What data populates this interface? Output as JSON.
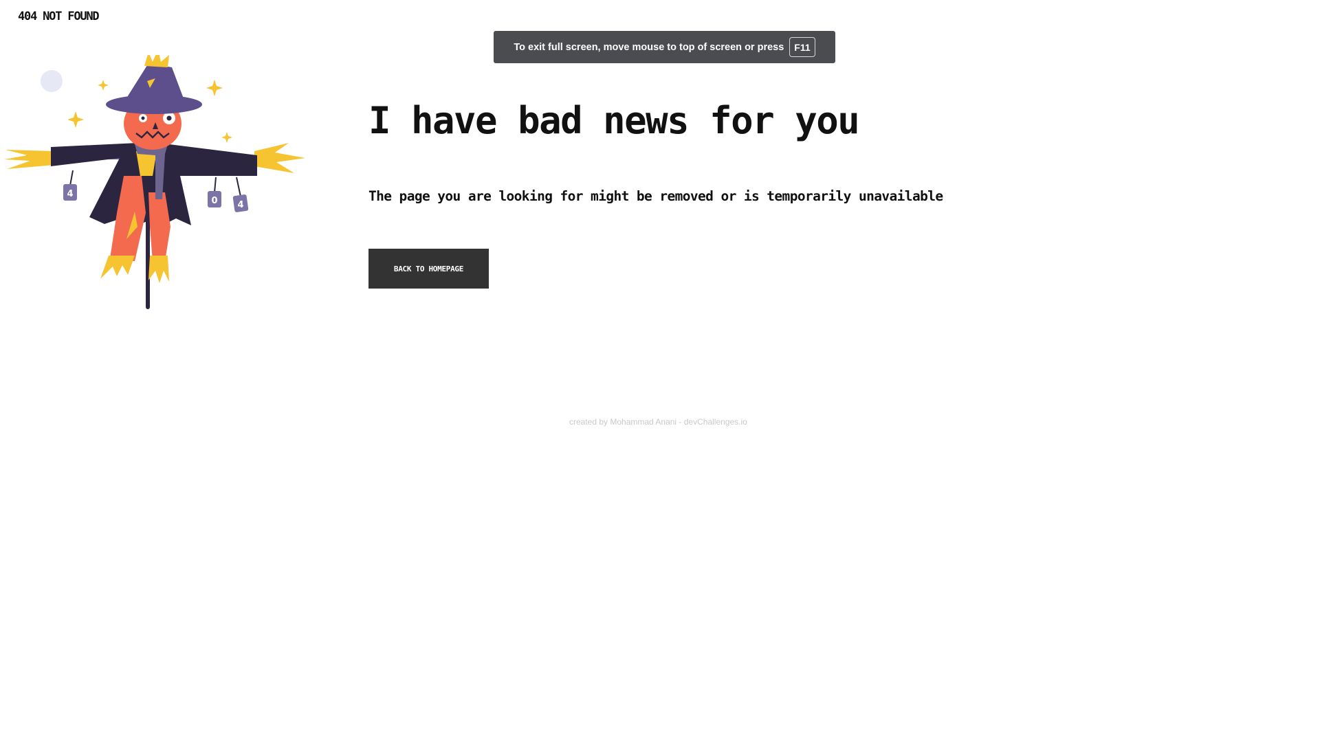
{
  "brand": {
    "label": "404 NOT FOUND"
  },
  "fullscreen_notice": {
    "text": "To exit full screen, move mouse to top of screen or press",
    "key": "F11"
  },
  "illustration": {
    "icon": "scarecrow-illustration",
    "tag_labels": [
      "4",
      "0",
      "4"
    ],
    "colors": {
      "hat": "#5c4f8c",
      "face": "#f46a4e",
      "coat": "#2c2540",
      "scarf": "#6e6490",
      "straw": "#f5c430",
      "pants": "#f46a4e",
      "moon": "#e7e8f5"
    }
  },
  "main": {
    "headline": "I have bad news for you",
    "subtext": "The page you are looking for might be removed or is temporarily unavailable",
    "cta_label": "BACK TO HOMEPAGE"
  },
  "footer": {
    "text": "created by Mohammad Anani - devChallenges.io"
  },
  "colors": {
    "button_bg": "#333333",
    "toast_bg": "#4a4c4f",
    "text": "#111111",
    "footer_text": "#c9c9c9"
  }
}
